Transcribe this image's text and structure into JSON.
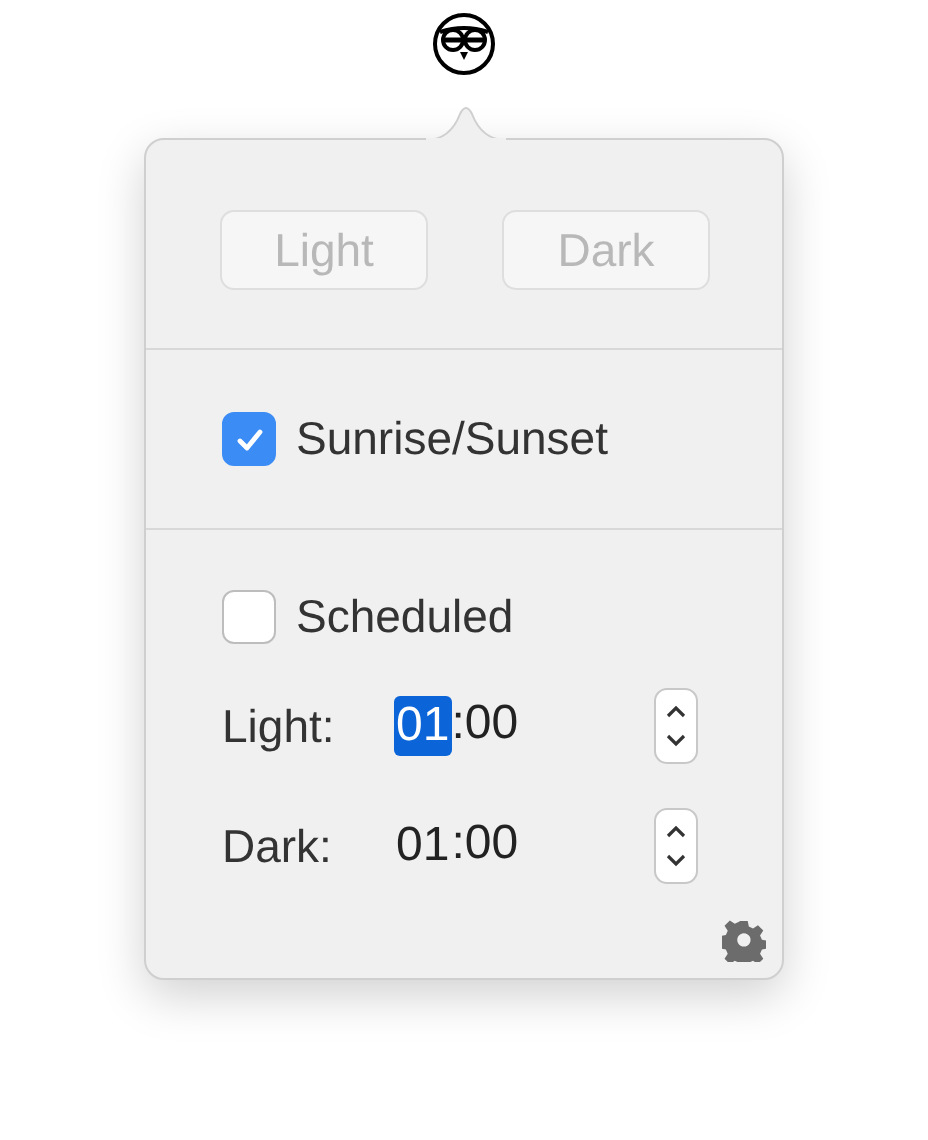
{
  "mode_buttons": [
    {
      "label": "Light",
      "disabled": true
    },
    {
      "label": "Dark",
      "disabled": true
    }
  ],
  "sunrise_sunset": {
    "label": "Sunrise/Sunset",
    "checked": true
  },
  "scheduled": {
    "label": "Scheduled",
    "checked": false
  },
  "times": [
    {
      "label": "Light:",
      "hours": "01",
      "separator": ":",
      "minutes": "00",
      "hours_selected": true
    },
    {
      "label": "Dark:",
      "hours": "01",
      "separator": ":",
      "minutes": "00",
      "hours_selected": false
    }
  ]
}
